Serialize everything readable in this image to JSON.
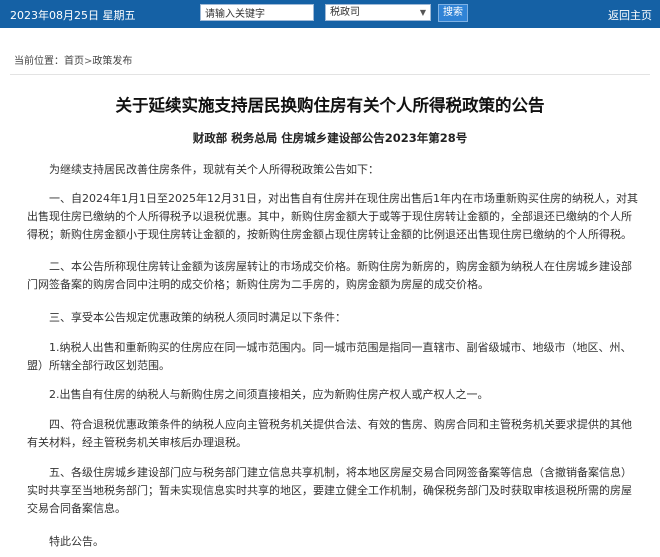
{
  "topbar": {
    "date": "2023年08月25日  星期五",
    "search_placeholder": "请输入关键字",
    "select_value": "税政司",
    "search_label": "搜索",
    "home_link": "返回主页"
  },
  "breadcrumb": {
    "prefix": "当前位置：",
    "home": "首页",
    "sep": ">",
    "current": "政策发布"
  },
  "article": {
    "title": "关于延续实施支持居民换购住房有关个人所得税政策的公告",
    "subtitle": "财政部  税务总局  住房城乡建设部公告2023年第28号",
    "paragraphs": [
      "为继续支持居民改善住房条件，现就有关个人所得税政策公告如下：",
      "一、自2024年1月1日至2025年12月31日，对出售自有住房并在现住房出售后1年内在市场重新购买住房的纳税人，对其出售现住房已缴纳的个人所得税予以退税优惠。其中，新购住房金额大于或等于现住房转让金额的，全部退还已缴纳的个人所得税；新购住房金额小于现住房转让金额的，按新购住房金额占现住房转让金额的比例退还出售现住房已缴纳的个人所得税。",
      "二、本公告所称现住房转让金额为该房屋转让的市场成交价格。新购住房为新房的，购房金额为纳税人在住房城乡建设部门网签备案的购房合同中注明的成交价格；新购住房为二手房的，购房金额为房屋的成交价格。",
      "三、享受本公告规定优惠政策的纳税人须同时满足以下条件：",
      "1.纳税人出售和重新购买的住房应在同一城市范围内。同一城市范围是指同一直辖市、副省级城市、地级市（地区、州、盟）所辖全部行政区划范围。",
      "2.出售自有住房的纳税人与新购住房之间须直接相关，应为新购住房产权人或产权人之一。",
      "四、符合退税优惠政策条件的纳税人应向主管税务机关提供合法、有效的售房、购房合同和主管税务机关要求提供的其他有关材料，经主管税务机关审核后办理退税。",
      "五、各级住房城乡建设部门应与税务部门建立信息共享机制，将本地区房屋交易合同网签备案等信息（含撤销备案信息）实时共享至当地税务部门；暂未实现信息实时共享的地区，要建立健全工作机制，确保税务部门及时获取审核退税所需的房屋交易合同备案信息。",
      "特此公告。"
    ]
  },
  "colors": {
    "topbar_bg": "#1561a5",
    "button_bg": "#2f83d6"
  }
}
